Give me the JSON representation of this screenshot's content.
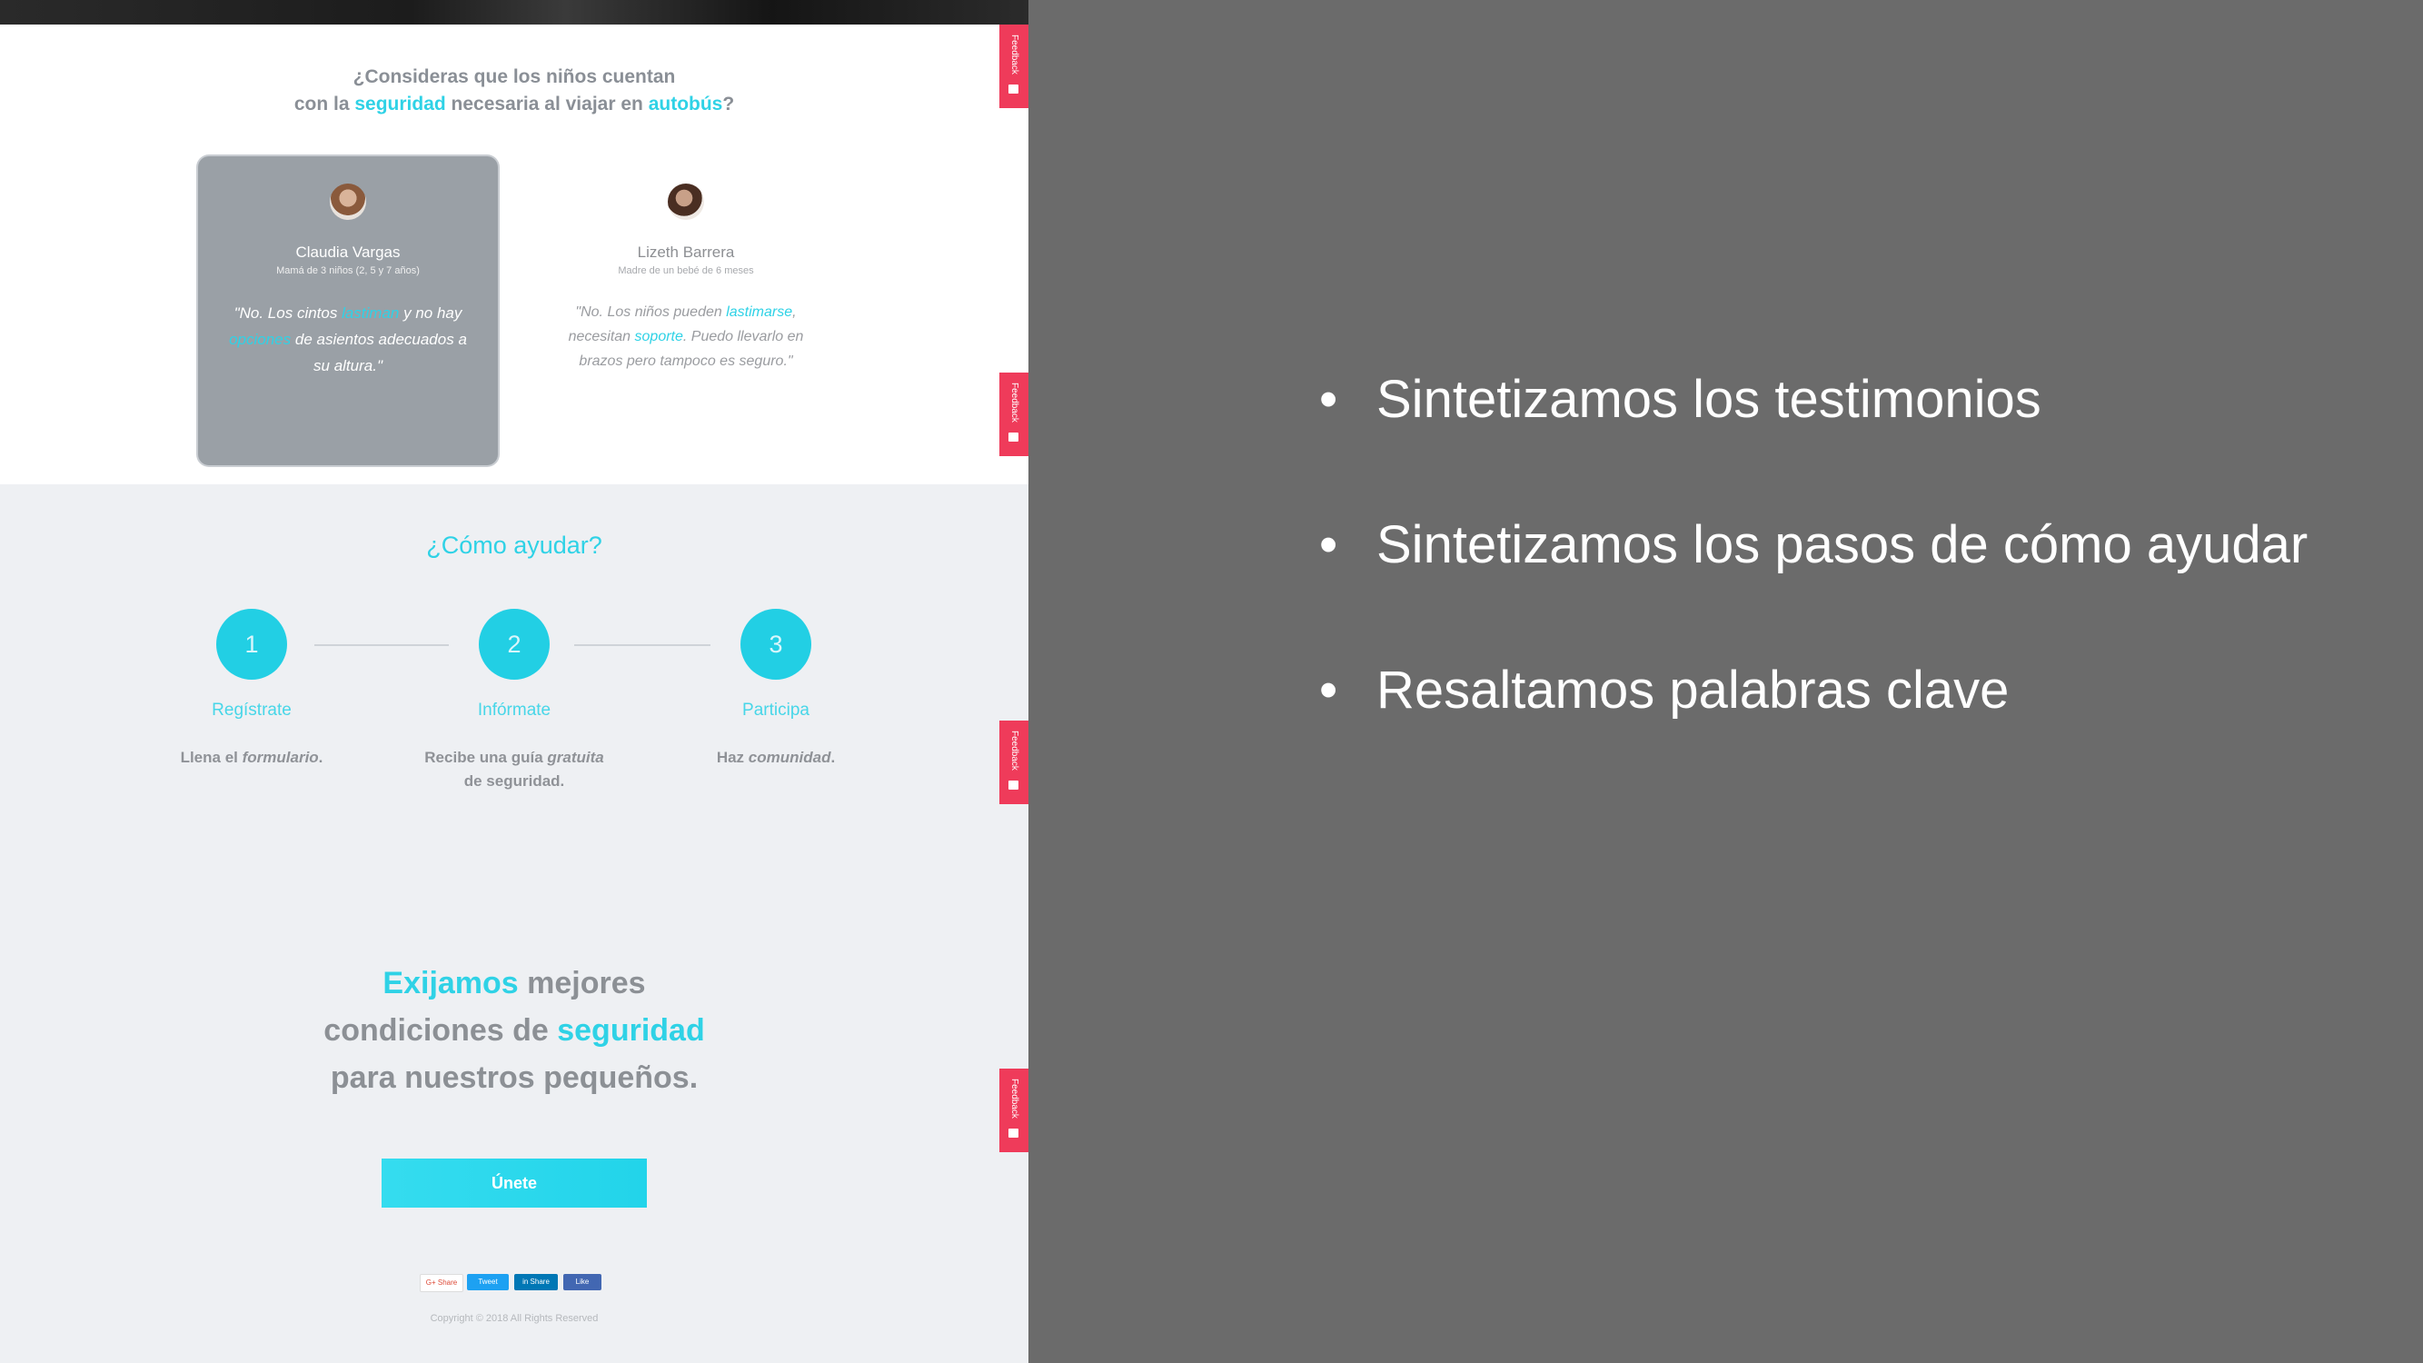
{
  "survey": {
    "question_line1": "¿Consideras que los niños cuentan",
    "question_line2_a": "con la ",
    "question_line2_hl1": "seguridad",
    "question_line2_b": " necesaria al viajar en ",
    "question_line2_hl2": "autobús",
    "question_line2_c": "?"
  },
  "testimonials": [
    {
      "name": "Claudia Vargas",
      "role": "Mamá de 3 niños (2, 5 y 7 años)",
      "quote_a": "\"No. Los cintos ",
      "quote_hl1": "lastiman",
      "quote_b": " y no hay ",
      "quote_hl2": "opciones",
      "quote_c": " de asientos adecuados a su altura.\""
    },
    {
      "name": "Lizeth Barrera",
      "role": "Madre de un bebé de 6 meses",
      "quote_a": "\"No. Los niños pueden ",
      "quote_hl1": "lastimarse",
      "quote_b": ", necesitan ",
      "quote_hl2": "soporte",
      "quote_c": ". Puedo llevarlo en brazos pero tampoco es seguro.\""
    }
  ],
  "how": {
    "title": "¿Cómo ayudar?",
    "steps": [
      {
        "number": "1",
        "label": "Regístrate",
        "desc_a": "Llena el ",
        "desc_em": "formulario",
        "desc_b": "."
      },
      {
        "number": "2",
        "label": "Infórmate",
        "desc_a": "Recibe una guía ",
        "desc_em": "gratuita",
        "desc_b": " de seguridad."
      },
      {
        "number": "3",
        "label": "Participa",
        "desc_a": "Haz ",
        "desc_em": "comunidad",
        "desc_b": "."
      }
    ]
  },
  "cta": {
    "hl1": "Exijamos",
    "text1": " mejores",
    "text2": "condiciones de ",
    "hl2": "seguridad",
    "text3": "para nuestros pequeños.",
    "button": "Únete"
  },
  "share_buttons": [
    {
      "label": "G+ Share",
      "color": "#ffffff",
      "text_color": "#dd4b39"
    },
    {
      "label": "Tweet",
      "color": "#1da1f2",
      "text_color": "#ffffff"
    },
    {
      "label": "in Share",
      "color": "#0077b5",
      "text_color": "#ffffff"
    },
    {
      "label": "Like",
      "color": "#4267b2",
      "text_color": "#ffffff"
    }
  ],
  "copyright": "Copyright © 2018 All Rights Reserved",
  "feedback_tab": "Feedback",
  "slide_bullets": [
    "Sintetizamos los testimonios",
    "Sintetizamos los pasos de cómo ayudar",
    "Resaltamos palabras clave"
  ],
  "colors": {
    "accent": "#2fd2e6",
    "feedback": "#ef3b5a",
    "slide_bg": "#6b6b6b",
    "section_bg": "#eef0f3"
  }
}
